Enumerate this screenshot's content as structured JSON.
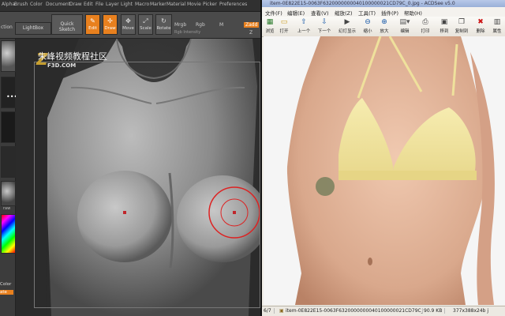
{
  "zbrush": {
    "menu": [
      "Alpha",
      "Brush",
      "Color",
      "Document",
      "Draw",
      "Edit",
      "File",
      "Layer",
      "Light",
      "Macro",
      "Marker",
      "Material",
      "Movie",
      "Picker",
      "Preferences"
    ],
    "toolbar": {
      "projection": "ction",
      "lightbox": "LightBox",
      "quick_sketch": "Quick Sketch",
      "edit": "Edit",
      "draw": "Draw",
      "move": "Move",
      "scale": "Scale",
      "rotate": "Rotate",
      "mrgb": "Mrgb",
      "rgb": "Rgb",
      "rgb_intensity": "Rgb Intensity",
      "m": "M",
      "zadd": "Zadd",
      "z": "Z"
    },
    "side": {
      "color_label": "Color",
      "ate": "ate",
      "raw": "raw"
    },
    "watermark": {
      "title": "朱峰视频教程社区",
      "sub": "F3D.COM"
    },
    "accent": "#e8801e"
  },
  "acdsee": {
    "title": "item-0E822E15-0063F6320000000040100000021CD79C_0.jpg - ACDSee v5.0",
    "menu": [
      "文件(F)",
      "编辑(E)",
      "查看(V)",
      "缩放(Z)",
      "工具(T)",
      "插件(P)",
      "帮助(H)"
    ],
    "toolbar": [
      "浏览",
      "打开",
      "上一个",
      "下一个",
      "幻灯显示",
      "缩小",
      "放大",
      "编辑",
      "打印",
      "移到",
      "复制到",
      "删除",
      "属性"
    ],
    "toolbar_icons": [
      "browse-icon",
      "open-icon",
      "prev-icon",
      "next-icon",
      "slideshow-icon",
      "zoom-out-icon",
      "zoom-in-icon",
      "edit-icon",
      "print-icon",
      "move-icon",
      "copy-icon",
      "delete-icon",
      "properties-icon"
    ],
    "status": {
      "index": "6/7",
      "file": "item-0E822E15-0063F6320000000040100000021CD79C_0.jpg",
      "size": "90.9 KB",
      "dims": "377x388x24b j"
    }
  }
}
